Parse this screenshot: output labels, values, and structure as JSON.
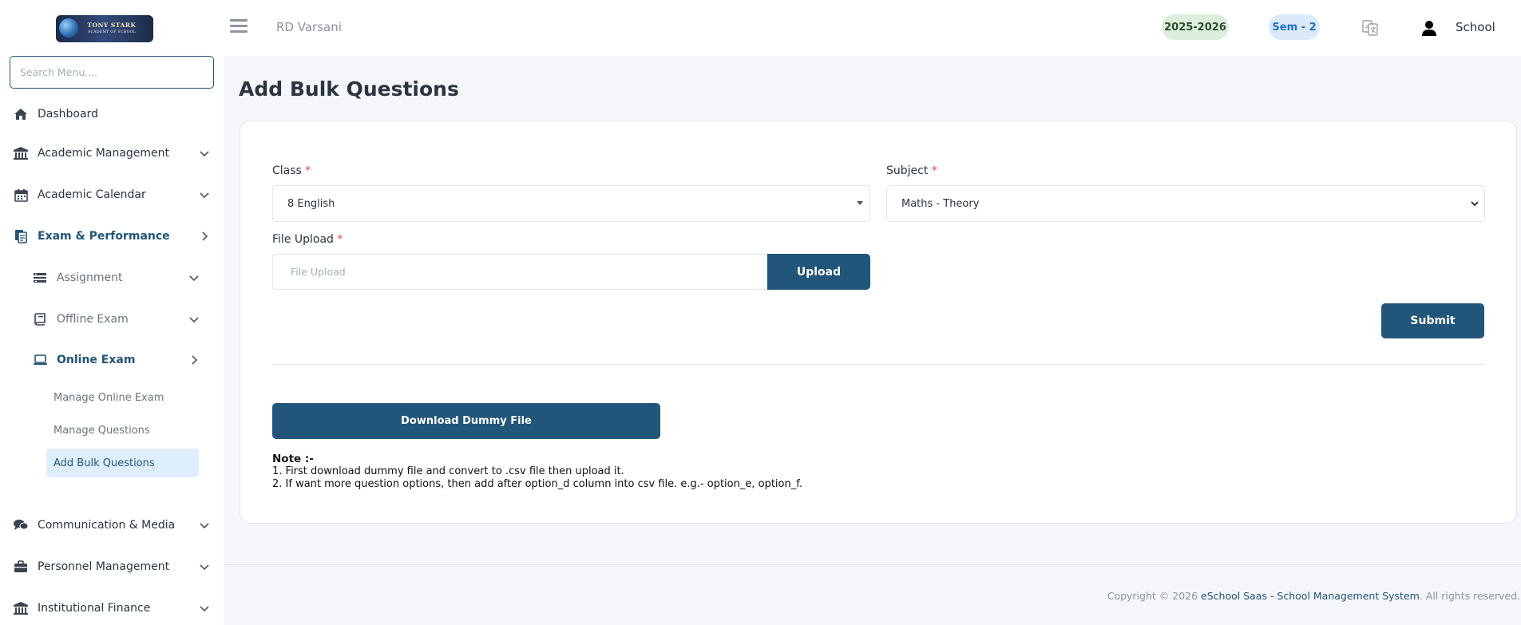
{
  "logo": {
    "line1": "TONY STARK",
    "line2": "ACADEMY OF SCHOOL"
  },
  "sidebar": {
    "search_placeholder": "Search Menu....",
    "items": [
      {
        "label": "Dashboard",
        "icon": "home-icon"
      },
      {
        "label": "Academic Management",
        "icon": "bank-icon"
      },
      {
        "label": "Academic Calendar",
        "icon": "calendar-icon"
      },
      {
        "label": "Exam & Performance",
        "icon": "exam-icon"
      },
      {
        "label": "Assignment",
        "icon": "assignment-icon"
      },
      {
        "label": "Offline Exam",
        "icon": "book-icon"
      },
      {
        "label": "Online Exam",
        "icon": "laptop-icon"
      },
      {
        "label": "Manage Online Exam"
      },
      {
        "label": "Manage Questions"
      },
      {
        "label": "Add Bulk Questions"
      },
      {
        "label": "Communication & Media",
        "icon": "chat-icon"
      },
      {
        "label": "Personnel Management",
        "icon": "briefcase-icon"
      },
      {
        "label": "Institutional Finance",
        "icon": "bank-icon"
      }
    ]
  },
  "header": {
    "school_name": "RD Varsani",
    "session": "2025-2026",
    "semester": "Sem - 2",
    "user_label": "School"
  },
  "page": {
    "title": "Add Bulk Questions",
    "class_label": "Class",
    "class_value": "8 English",
    "subject_label": "Subject",
    "subject_value": "Maths - Theory",
    "file_label": "File Upload",
    "file_placeholder": "File Upload",
    "upload_label": "Upload",
    "submit_label": "Submit",
    "download_label": "Download Dummy File",
    "required_mark": "*",
    "note_title": "Note :-",
    "note_1": "1. First download dummy file and convert to .csv file then upload it.",
    "note_2": "2. If want more question options, then add after option_d column into csv file. e.g.- option_e, option_f."
  },
  "footer": {
    "prefix": "Copyright © 2026 ",
    "link": "eSchool Saas - School Management System",
    "suffix": ". All rights reserved."
  },
  "colors": {
    "primary": "#22557a",
    "required": "#e0474c",
    "year_badge_bg": "#dcefdc",
    "sem_badge_bg": "#dbe9fb",
    "selected_bg": "#dfeefd"
  }
}
